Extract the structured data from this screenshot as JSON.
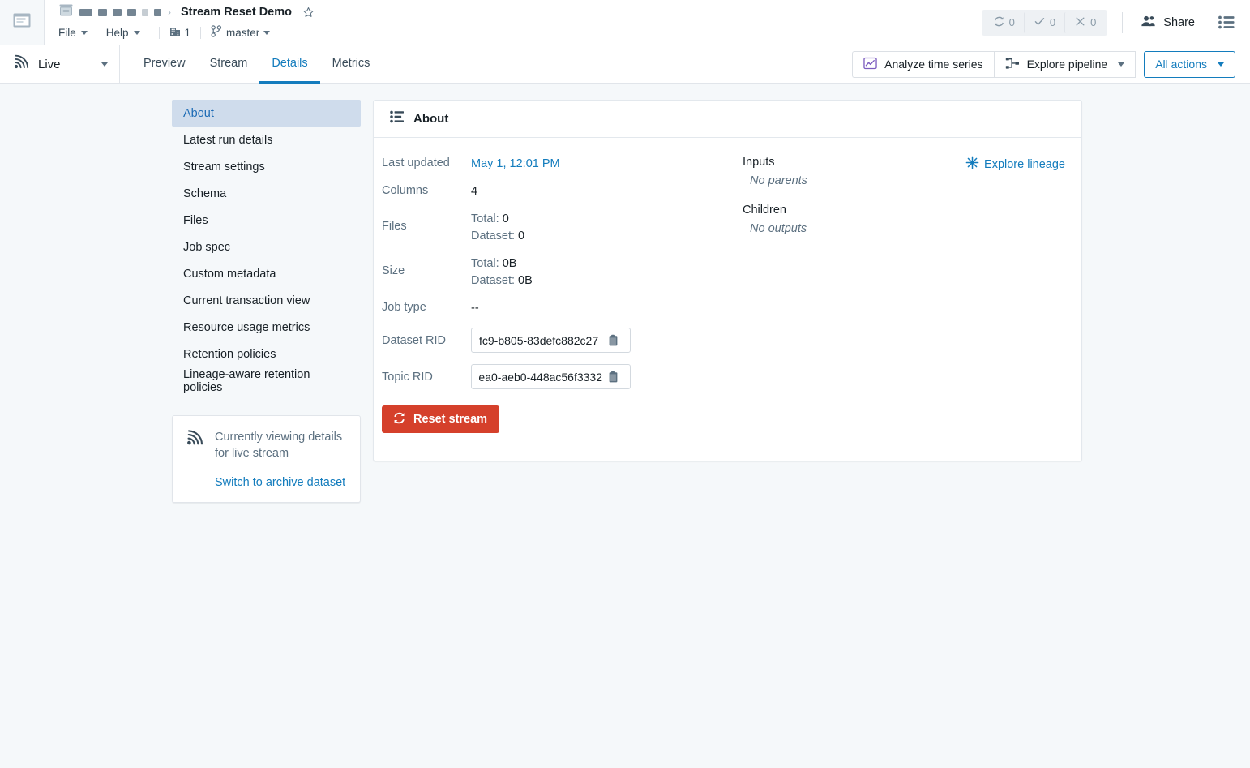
{
  "topbar": {
    "panel_toggle_icon": "panel-layout-icon",
    "breadcrumb": {
      "folder_icon": "archive-folder-icon",
      "redacted_segments": [
        16,
        11,
        11,
        11,
        8,
        9
      ],
      "separator": "›"
    },
    "title": "Stream Reset Demo",
    "star_icon": "star-outline-icon",
    "menus": [
      {
        "label": "File",
        "caret": true
      },
      {
        "label": "Help",
        "caret": true
      }
    ],
    "org_icon": "building-grid-icon",
    "org_count": "1",
    "branch_icon": "git-branch-icon",
    "branch": "master",
    "status_chips": [
      {
        "icon": "refresh-icon",
        "count": "0"
      },
      {
        "icon": "check-icon",
        "count": "0"
      },
      {
        "icon": "cross-icon",
        "count": "0"
      }
    ],
    "share_icon": "people-icon",
    "share_label": "Share",
    "list_icon": "list-menu-icon"
  },
  "subbar": {
    "live_icon": "broadcast-icon",
    "live_label": "Live",
    "tabs": [
      {
        "label": "Preview",
        "active": false
      },
      {
        "label": "Stream",
        "active": false
      },
      {
        "label": "Details",
        "active": true
      },
      {
        "label": "Metrics",
        "active": false
      }
    ],
    "actions": [
      {
        "label": "Analyze time series",
        "icon": "timeseries-chart-icon",
        "caret": false
      },
      {
        "label": "Explore pipeline",
        "icon": "pipeline-icon",
        "caret": true
      },
      {
        "label": "All actions",
        "icon": null,
        "caret": true,
        "outlined": true
      }
    ]
  },
  "sidebar": {
    "items": [
      {
        "label": "About",
        "active": true
      },
      {
        "label": "Latest run details",
        "active": false
      },
      {
        "label": "Stream settings",
        "active": false
      },
      {
        "label": "Schema",
        "active": false
      },
      {
        "label": "Files",
        "active": false
      },
      {
        "label": "Job spec",
        "active": false
      },
      {
        "label": "Custom metadata",
        "active": false
      },
      {
        "label": "Current transaction view",
        "active": false
      },
      {
        "label": "Resource usage metrics",
        "active": false
      },
      {
        "label": "Retention policies",
        "active": false
      },
      {
        "label": "Lineage-aware retention policies",
        "active": false
      }
    ],
    "viewing_card": {
      "icon": "broadcast-icon",
      "text": "Currently viewing details for live stream",
      "link": "Switch to archive dataset"
    }
  },
  "about": {
    "header_icon": "properties-list-icon",
    "header_title": "About",
    "fields": {
      "last_updated_label": "Last updated",
      "last_updated_value": "May 1, 12:01 PM",
      "columns_label": "Columns",
      "columns_value": "4",
      "files_label": "Files",
      "files_total_label": "Total:",
      "files_total_value": "0",
      "files_dataset_label": "Dataset:",
      "files_dataset_value": "0",
      "size_label": "Size",
      "size_total_label": "Total:",
      "size_total_value": "0B",
      "size_dataset_label": "Dataset:",
      "size_dataset_value": "0B",
      "job_type_label": "Job type",
      "job_type_value": "--",
      "dataset_rid_label": "Dataset RID",
      "dataset_rid_value": "fc9-b805-83defc882c27",
      "topic_rid_label": "Topic RID",
      "topic_rid_value": "ea0-aeb0-448ac56f3332",
      "copy_icon": "clipboard-icon"
    },
    "reset_button": {
      "label": "Reset stream",
      "icon": "refresh-icon",
      "color": "#d5402b"
    },
    "lineage": {
      "explore_label": "Explore lineage",
      "explore_icon": "lineage-graph-icon",
      "inputs_label": "Inputs",
      "inputs_empty": "No parents",
      "children_label": "Children",
      "children_empty": "No outputs"
    }
  },
  "colors": {
    "accent_blue": "#137cbd",
    "danger_red": "#d5402b",
    "active_nav_bg": "#cfdcec",
    "page_bg": "#f5f8fa"
  }
}
